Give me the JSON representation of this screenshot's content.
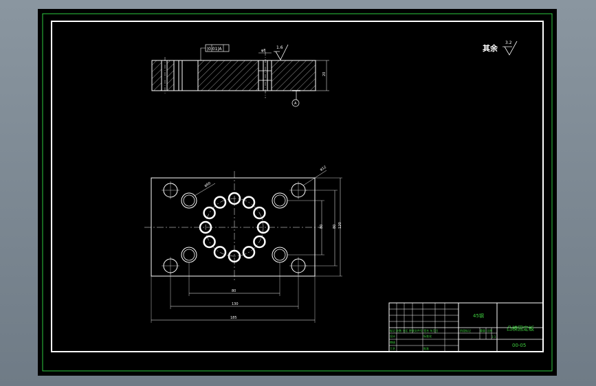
{
  "colors": {
    "background": "#7c8893",
    "sheet": "#000000",
    "frame_outer": "#2ecc40",
    "lines": "#ffffff",
    "title_block_text": "#3fd23f"
  },
  "section_view": {
    "roughness_value": "1.6",
    "tolerance_frame": "|0.01|A",
    "hole_note": "φ8",
    "datum_label": "A",
    "thickness_dim": "20"
  },
  "roughness_note": {
    "label": "其余",
    "value": "3.2"
  },
  "plan_view": {
    "pitch_circle": "φ60",
    "corner_hole": "φ12",
    "dim_inner_width": "80",
    "dim_mid_width": "130",
    "dim_overall_width": "185",
    "dim_inner_height": "80",
    "dim_overall_height": "120"
  },
  "title_block": {
    "material": "45钢",
    "part_name": "凸模固定板",
    "drawing_number": "00-05",
    "scale": "1:1",
    "stage_label": "阶段标记",
    "weight_label": "重量",
    "scale_label": "比例",
    "header_row": "标记 处数 分区 更改文件号 签名 年月日",
    "designer_label": "设计",
    "standard_label": "标准化",
    "review_label": "审核",
    "craft_label": "工艺",
    "approve_label": "批准"
  }
}
